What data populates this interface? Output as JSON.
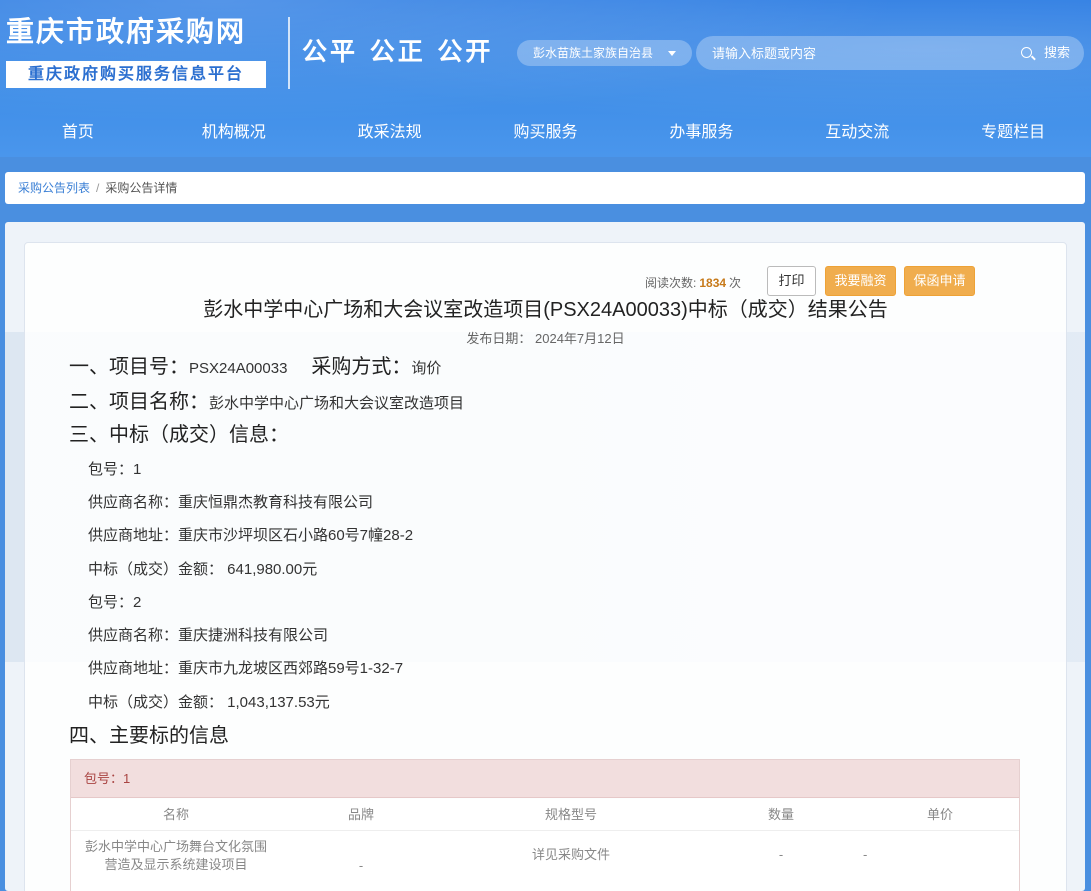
{
  "header": {
    "site_title": "重庆市政府采购网",
    "site_subtitle": "重庆政府购买服务信息平台",
    "slogan": "公平 公正 公开",
    "region": "彭水苗族土家族自治县",
    "search_placeholder": "请输入标题或内容",
    "search_label": "搜索"
  },
  "nav": {
    "items": [
      {
        "label": "首页"
      },
      {
        "label": "机构概况"
      },
      {
        "label": "政采法规"
      },
      {
        "label": "购买服务"
      },
      {
        "label": "办事服务"
      },
      {
        "label": "互动交流"
      },
      {
        "label": "专题栏目"
      }
    ]
  },
  "breadcrumb": {
    "link": "采购公告列表",
    "separator": "/",
    "current": "采购公告详情"
  },
  "notice": {
    "read_label": "阅读次数:",
    "read_count": "1834",
    "read_unit": "次",
    "print_label": "打印",
    "finance_label": "我要融资",
    "guarantee_label": "保函申请",
    "title": "彭水中学中心广场和大会议室改造项目(PSX24A00033)中标（成交）结果公告",
    "pub_date_label": "发布日期：",
    "pub_date": "2024年7月12日",
    "sec1_label": "一、项目号：",
    "project_no": "PSX24A00033",
    "method_label": "采购方式：",
    "method": "询价",
    "sec2_label": "二、项目名称：",
    "project_name": "彭水中学中心广场和大会议室改造项目",
    "sec3_label": "三、中标（成交）信息：",
    "lots": [
      {
        "pkg": "包号：1",
        "supplier": "供应商名称：重庆恒鼎杰教育科技有限公司",
        "address": "供应商地址：重庆市沙坪坝区石小路60号7幢28-2",
        "amount": "中标（成交）金额： 641,980.00元"
      },
      {
        "pkg": "包号：2",
        "supplier": "供应商名称：重庆捷洲科技有限公司",
        "address": "供应商地址：重庆市九龙坡区西郊路59号1-32-7",
        "amount": "中标（成交）金额： 1,043,137.53元"
      }
    ],
    "sec4_label": "四、主要标的信息",
    "table": {
      "pkg_label": "包号：1",
      "columns": [
        "名称",
        "品牌",
        "规格型号",
        "数量",
        "单价"
      ],
      "rows": [
        {
          "name": "彭水中学中心广场舞台文化氛围营造及显示系统建设项目",
          "brand": "-",
          "spec": "详见采购文件",
          "qty": "-",
          "price": "-"
        }
      ]
    }
  }
}
